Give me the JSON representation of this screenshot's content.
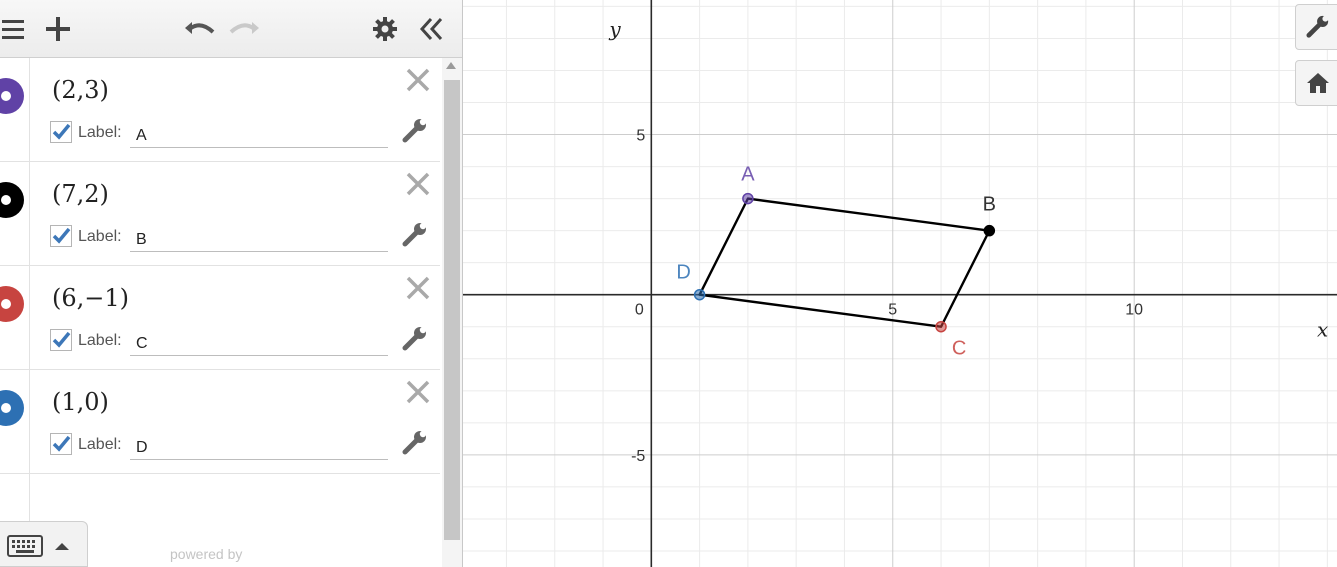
{
  "expressions": [
    {
      "latex": "(2,3)",
      "color": "#6042a6",
      "label_text": "Label:",
      "label_value": "A"
    },
    {
      "latex": "(7,2)",
      "color": "#000000",
      "label_text": "Label:",
      "label_value": "B"
    },
    {
      "latex": "(6,−1)",
      "color": "#c74440",
      "label_text": "Label:",
      "label_value": "C"
    },
    {
      "latex": "(1,0)",
      "color": "#2d70b3",
      "label_text": "Label:",
      "label_value": "D"
    }
  ],
  "footer": {
    "powered_by": "powered by"
  },
  "graph": {
    "x_axis_label": "x",
    "y_axis_label": "y",
    "x_ticks": [
      {
        "value": 0,
        "label": "0"
      },
      {
        "value": 5,
        "label": "5"
      },
      {
        "value": 10,
        "label": "10"
      }
    ],
    "y_ticks": [
      {
        "value": 5,
        "label": "5"
      },
      {
        "value": -5,
        "label": "-5"
      }
    ],
    "points": [
      {
        "name": "A",
        "x": 2,
        "y": 3,
        "color": "#6042a6"
      },
      {
        "name": "B",
        "x": 7,
        "y": 2,
        "color": "#000000"
      },
      {
        "name": "C",
        "x": 6,
        "y": -1,
        "color": "#c74440"
      },
      {
        "name": "D",
        "x": 1,
        "y": 0,
        "color": "#2d70b3"
      }
    ],
    "polygon": [
      "A",
      "B",
      "C",
      "D"
    ],
    "xlim": [
      -3.9,
      14.2
    ],
    "ylim": [
      -8.5,
      9.2
    ]
  },
  "icons": [
    "hamburger-icon",
    "plus-icon",
    "undo-icon",
    "redo-icon",
    "gear-icon",
    "collapse-icon",
    "close-icon",
    "wrench-icon",
    "keyboard-icon",
    "home-icon",
    "checkbox-checked-icon"
  ],
  "colors": {
    "accent": "#3d77b8",
    "grid_minor": "#ebebeb",
    "grid_major": "#cdcdcd",
    "axis": "#2a2a2a"
  }
}
